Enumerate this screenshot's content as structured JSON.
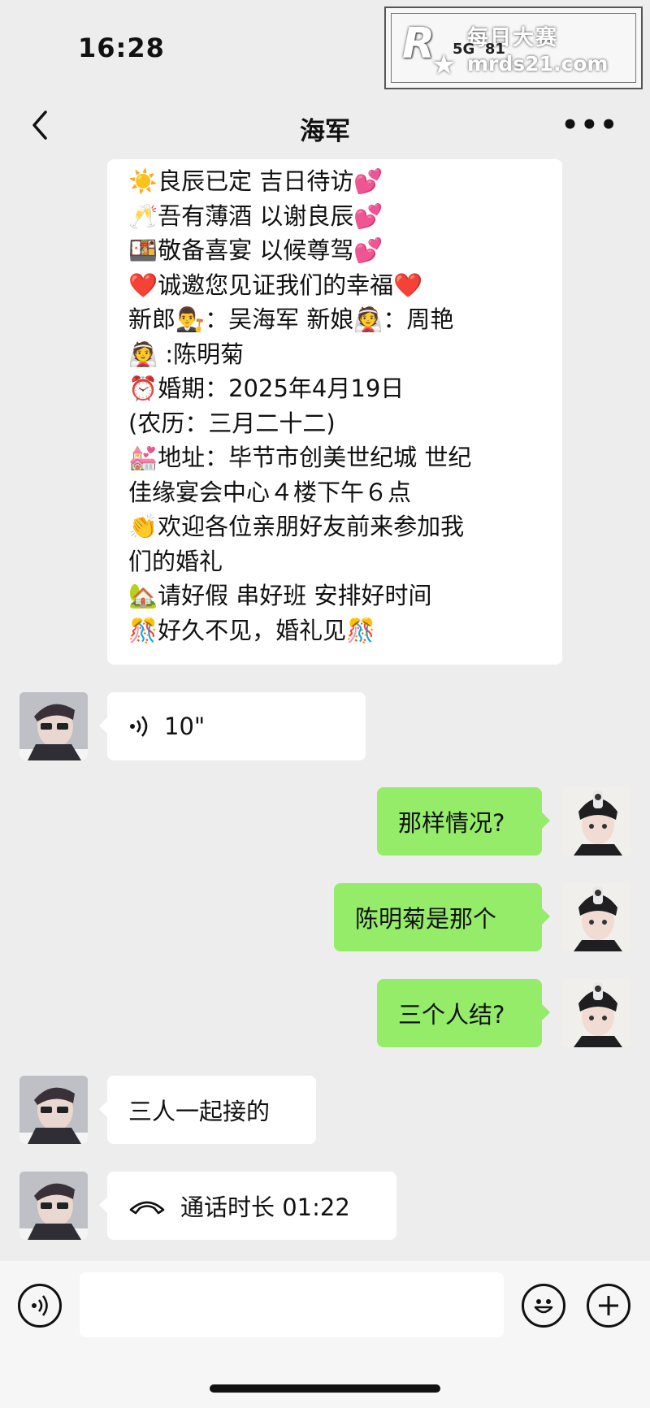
{
  "status": {
    "time": "16:28",
    "network": "5G",
    "battery": "81"
  },
  "watermark": {
    "logo": "R",
    "text_cn": "每日大赛",
    "url": "mrds21.com"
  },
  "nav": {
    "title": "海军"
  },
  "invitation": {
    "lines": [
      {
        "icon": "sun-icon",
        "emoji": "☀️",
        "text": "良辰已定 吉日待访",
        "trail": "💕"
      },
      {
        "icon": "champagne-icon",
        "emoji": "🥂",
        "text": "吾有薄酒 以谢良辰",
        "trail": "💕"
      },
      {
        "icon": "bento-icon",
        "emoji": "🍱",
        "text": "敬备喜宴 以候尊驾",
        "trail": "💕"
      },
      {
        "icon": "heart-icon",
        "emoji": "❤️",
        "text": "诚邀您见证我们的幸福",
        "trail": "❤️"
      },
      {
        "icon": "",
        "emoji": "",
        "text": "新郎👨‍⚖️：吴海军  新娘👰：周艳",
        "trail": ""
      },
      {
        "icon": "bride-icon",
        "emoji": "👰",
        "text": " :陈明菊",
        "trail": ""
      },
      {
        "icon": "alarm-clock-icon",
        "emoji": "⏰",
        "text": "婚期：2025年4月19日",
        "trail": ""
      },
      {
        "icon": "",
        "emoji": "",
        "text": "(农历：三月二十二)",
        "trail": ""
      },
      {
        "icon": "wedding-chapel-icon",
        "emoji": "💒",
        "text": "地址：毕节市创美世纪城  世纪",
        "trail": ""
      },
      {
        "icon": "",
        "emoji": "",
        "text": "佳缘宴会中心４楼下午６点",
        "trail": ""
      },
      {
        "icon": "clapping-hands-icon",
        "emoji": "👏",
        "text": "欢迎各位亲朋好友前来参加我",
        "trail": ""
      },
      {
        "icon": "",
        "emoji": "",
        "text": "们的婚礼",
        "trail": ""
      },
      {
        "icon": "house-icon",
        "emoji": "🏡",
        "text": "请好假 串好班 安排好时间",
        "trail": ""
      },
      {
        "icon": "confetti-icon",
        "emoji": "🎊",
        "text": "好久不见，婚礼见",
        "trail": "🎊"
      }
    ]
  },
  "messages": {
    "voice": {
      "duration": "10\""
    },
    "sent1": "那样情况?",
    "sent2": "陈明菊是那个",
    "sent3": "三个人结?",
    "received1": "三人一起接的",
    "call": {
      "label": "通话时长 01:22"
    }
  },
  "input": {
    "placeholder": ""
  }
}
